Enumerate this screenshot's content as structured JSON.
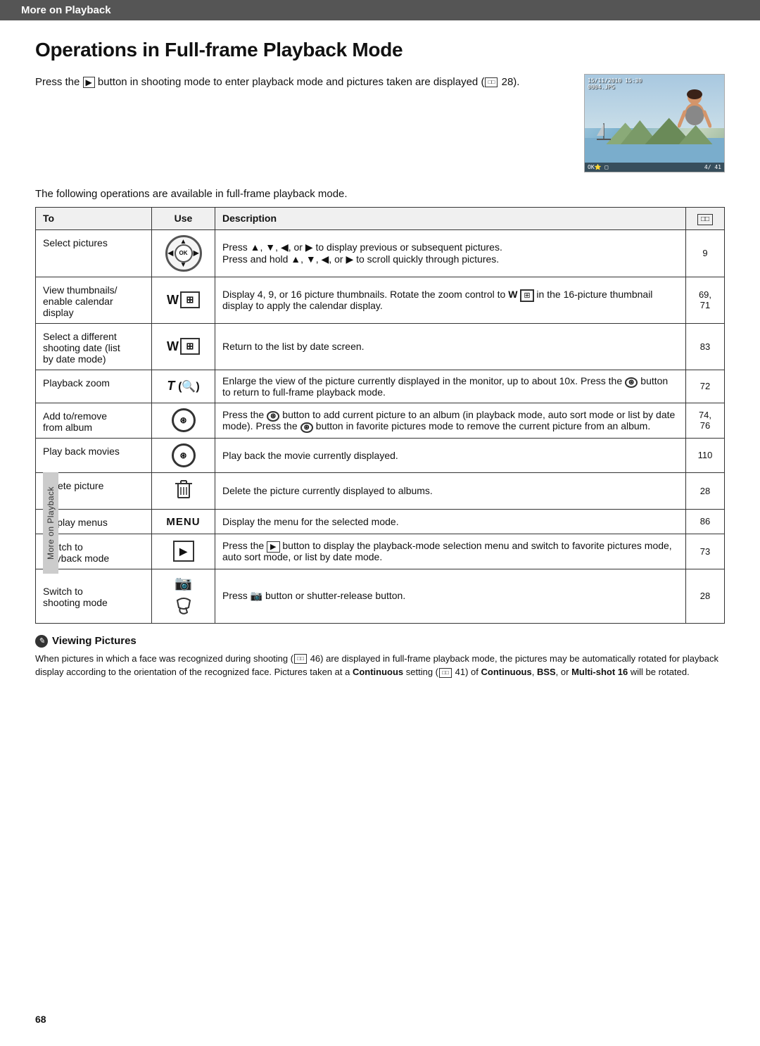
{
  "header": {
    "label": "More on Playback"
  },
  "page": {
    "title": "Operations in Full-frame Playback Mode",
    "page_number": "68",
    "sidebar_label": "More on Playback"
  },
  "intro": {
    "text": "Press the ▶ button in shooting mode to enter playback mode and pictures taken are displayed (□ 28).",
    "image_date": "15/11/2010 15:30",
    "image_filename": "0004.JPG",
    "image_counter": "4/ 41"
  },
  "table": {
    "intro_text": "The following operations are available in full-frame playback mode.",
    "headers": [
      "To",
      "Use",
      "Description",
      "□□"
    ],
    "rows": [
      {
        "to": "Select pictures",
        "use": "selector_ok",
        "description": "Press ▲, ▼, ◀, or ▶ to display previous or subsequent pictures.\nPress and hold ▲, ▼, ◀, or ▶ to scroll quickly through pictures.",
        "ref": "9"
      },
      {
        "to": "View thumbnails/\nenable calendar\ndisplay",
        "use": "W_bracket",
        "description": "Display 4, 9, or 16 picture thumbnails. Rotate the zoom control to W (⊞) in the 16-picture thumbnail display to apply the calendar display.",
        "ref": "69, 71"
      },
      {
        "to": "Select a different\nshooting date (list\nby date mode)",
        "use": "W_bracket",
        "description": "Return to the list by date screen.",
        "ref": "83"
      },
      {
        "to": "Playback zoom",
        "use": "T_q",
        "description": "Enlarge the view of the picture currently displayed in the monitor, up to about 10x. Press the ⊛ button to return to full-frame playback mode.",
        "ref": "72"
      },
      {
        "to": "Add to/remove\nfrom album",
        "use": "ok_circle",
        "description": "Press the ⊛ button to add current picture to an album (in playback mode, auto sort mode or list by date mode). Press the ⊛ button in favorite pictures mode to remove the current picture from an album.",
        "ref": "74, 76"
      },
      {
        "to": "Play back movies",
        "use": "ok_circle",
        "description": "Play back the movie currently displayed.",
        "ref": "110"
      },
      {
        "to": "Delete picture",
        "use": "trash",
        "description": "Delete the picture currently displayed to albums.",
        "ref": "28"
      },
      {
        "to": "Display menus",
        "use": "menu_text",
        "description": "Display the menu for the selected mode.",
        "ref": "86"
      },
      {
        "to": "Switch to\nplayback mode",
        "use": "play_button",
        "description": "Press the ▶ button to display the playback-mode selection menu and switch to favorite pictures mode, auto sort mode, or list by date mode.",
        "ref": "73"
      },
      {
        "to": "Switch to\nshooting mode",
        "use": "camera_and_arrow",
        "description": "Press 🎥 button or shutter-release button.",
        "ref": "28"
      }
    ]
  },
  "note": {
    "icon": "✎",
    "title": "Viewing Pictures",
    "text": "When pictures in which a face was recognized during shooting (□□ 46) are displayed in full-frame playback mode, the pictures may be automatically rotated for playback display according to the orientation of the recognized face. Pictures taken at a Continuous setting (□□ 41) of Continuous, BSS, or Multi-shot 16 will be rotated."
  }
}
